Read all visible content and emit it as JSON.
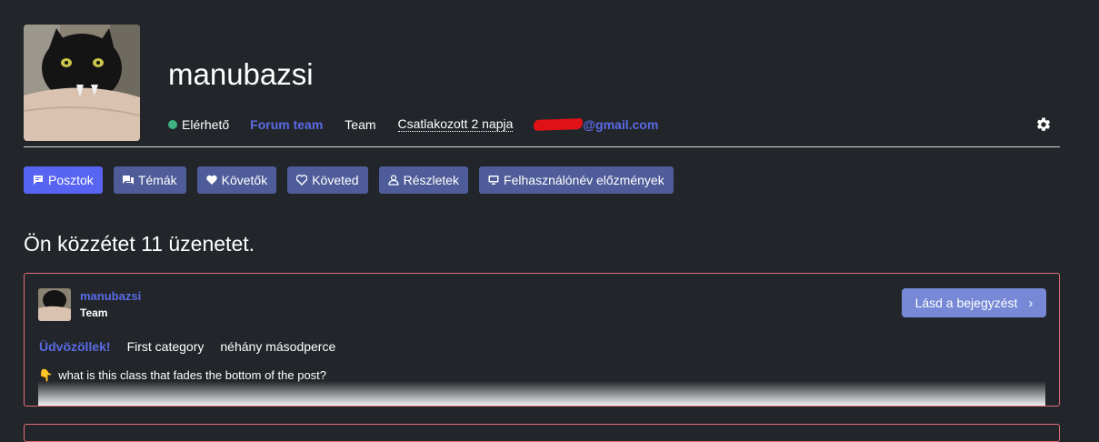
{
  "profile": {
    "username": "manubazsi",
    "status": "Elérhető",
    "group_badge": "Forum team",
    "role": "Team",
    "joined": "Csatlakozott 2 napja",
    "email_visible": "@gmail.com",
    "status_color": "#3fb27f"
  },
  "tabs": [
    {
      "label": "Posztok",
      "icon": "message-icon",
      "active": true
    },
    {
      "label": "Témák",
      "icon": "topics-icon",
      "active": false
    },
    {
      "label": "Követők",
      "icon": "heart-icon",
      "active": false
    },
    {
      "label": "Követed",
      "icon": "heart-outline-icon",
      "active": false
    },
    {
      "label": "Részletek",
      "icon": "user-icon",
      "active": false
    },
    {
      "label": "Felhasználónév előzmények",
      "icon": "monitor-icon",
      "active": false
    }
  ],
  "heading": "Ön közzétet 11 üzenetet.",
  "post": {
    "author": "manubazsi",
    "role": "Team",
    "see_post_label": "Lásd a bejegyzést",
    "category": "Üdvözöllek!",
    "subcategory": "First category",
    "time": "néhány másodperce",
    "excerpt": "what is this class that fades the bottom of the post?"
  },
  "colors": {
    "accent": "#5865f2",
    "tab_bg": "#4e5c99",
    "card_border": "#e06d78",
    "link": "#5a6ae6"
  }
}
